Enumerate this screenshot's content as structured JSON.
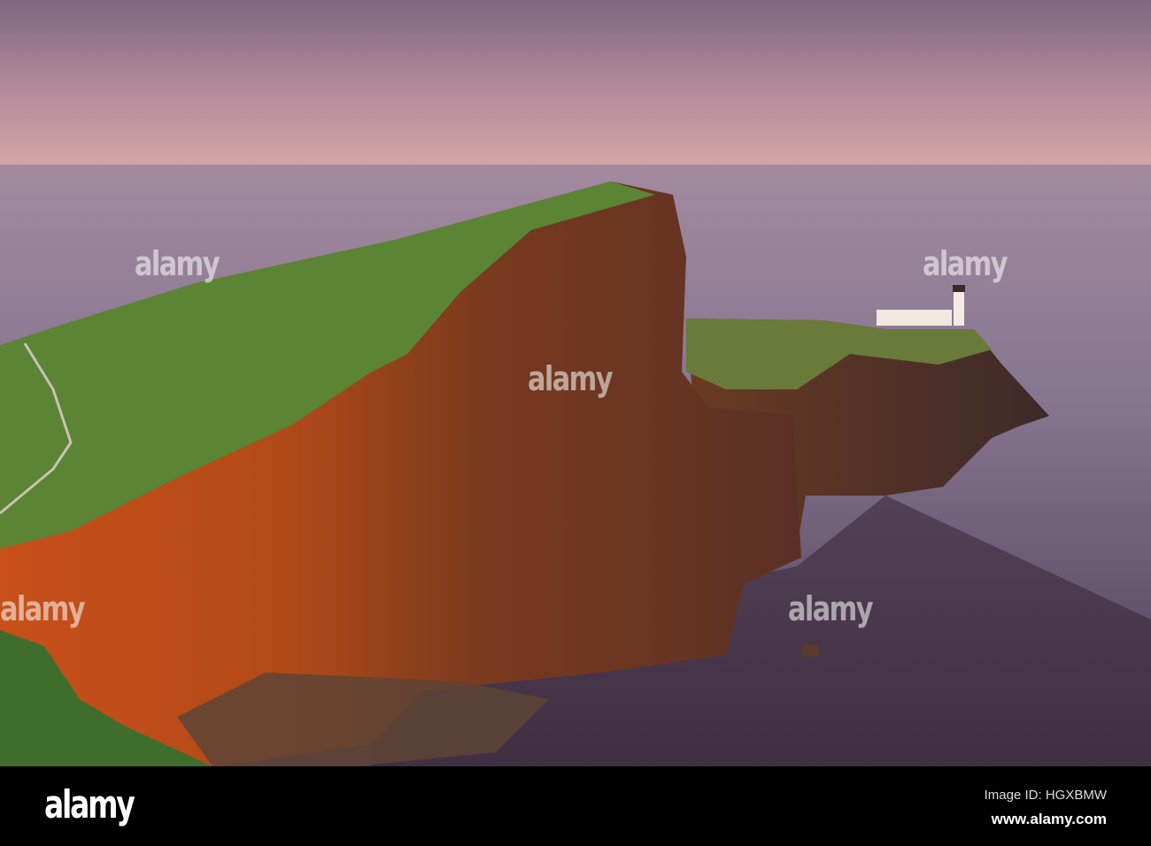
{
  "photo": {
    "subject": "Neist Point cliffs and lighthouse at sunset",
    "colors": {
      "sky_top": "#8a6f86",
      "sky_horizon": "#d4a3a6",
      "sea": "#8a7a95",
      "sea_dark": "#2e1e2c",
      "cliff_lit": "#c8561c",
      "cliff_shadow": "#4a2a1e",
      "grass": "#4f7a32"
    }
  },
  "watermark": {
    "text": "alamy"
  },
  "footer": {
    "logo": "alamy",
    "image_id": "Image ID: HGXBMW",
    "website": "www.alamy.com"
  }
}
